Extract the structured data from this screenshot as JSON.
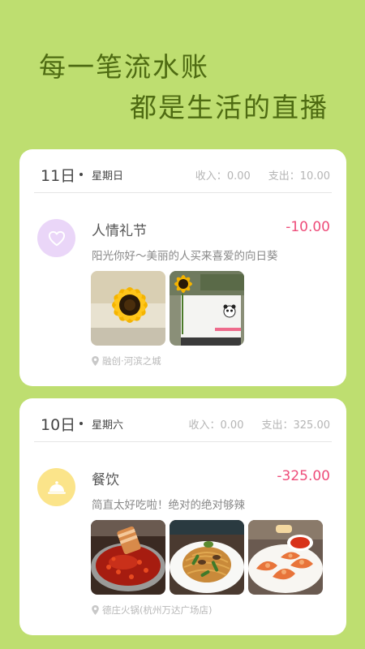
{
  "hero": {
    "line1": "每一笔流水账",
    "line2": "都是生活的直播"
  },
  "days": [
    {
      "day": "11日",
      "weekday": "星期日",
      "income_label": "收入：",
      "income_value": "0.00",
      "expense_label": "支出：",
      "expense_value": "10.00",
      "entry": {
        "category": "人情礼节",
        "category_icon": "heart-icon",
        "icon_color": "#ead6f8",
        "amount": "-10.00",
        "description": "阳光你好～美丽的人买来喜爱的向日葵",
        "location": "融创·河滨之城",
        "photos": [
          "sunflower-photo",
          "sunflower-panda-photo"
        ]
      }
    },
    {
      "day": "10日",
      "weekday": "星期六",
      "income_label": "收入：",
      "income_value": "0.00",
      "expense_label": "支出：",
      "expense_value": "325.00",
      "entry": {
        "category": "餐饮",
        "category_icon": "food-cloche-icon",
        "icon_color": "#fbe48a",
        "amount": "-325.00",
        "description": "简直太好吃啦！绝对的绝对够辣",
        "location": "德庄火锅(杭州万达广场店)",
        "photos": [
          "hotpot-photo",
          "noodles-photo",
          "shrimp-photo"
        ]
      }
    }
  ],
  "colors": {
    "background": "#bede70",
    "hero_text": "#4e6b12",
    "amount": "#ee4d7a"
  }
}
